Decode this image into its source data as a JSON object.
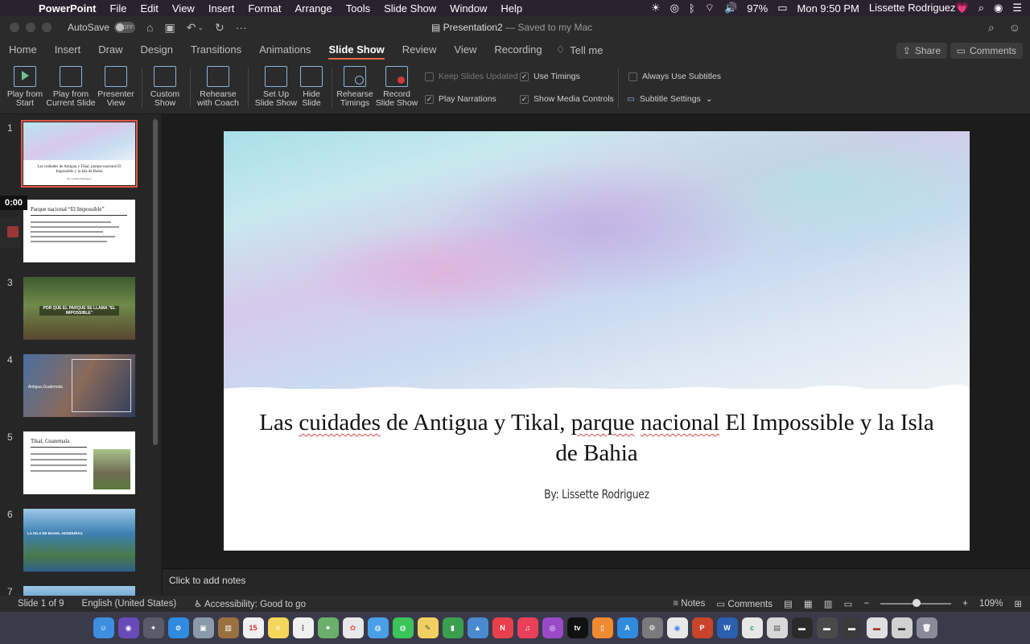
{
  "menubar": {
    "app_name": "PowerPoint",
    "menus": [
      "File",
      "Edit",
      "View",
      "Insert",
      "Format",
      "Arrange",
      "Tools",
      "Slide Show",
      "Window",
      "Help"
    ],
    "battery": "97%",
    "clock": "Mon 9:50 PM",
    "user": "Lissette Rodriguez💗"
  },
  "titlebar": {
    "autosave_label": "AutoSave",
    "autosave_state": "OFF",
    "doc_name": "Presentation2",
    "doc_status": "— Saved to my Mac"
  },
  "tabs": {
    "items": [
      "Home",
      "Insert",
      "Draw",
      "Design",
      "Transitions",
      "Animations",
      "Slide Show",
      "Review",
      "View",
      "Recording"
    ],
    "active": "Slide Show",
    "tell_me": "Tell me",
    "share": "Share",
    "comments": "Comments"
  },
  "ribbon": {
    "play_start": [
      "Play from",
      "Start"
    ],
    "play_current": [
      "Play from",
      "Current Slide"
    ],
    "presenter": [
      "Presenter",
      "View"
    ],
    "custom": [
      "Custom",
      "Show"
    ],
    "rehearse_coach": [
      "Rehearse",
      "with Coach"
    ],
    "setup": [
      "Set Up",
      "Slide Show"
    ],
    "hide": [
      "Hide",
      "Slide"
    ],
    "rehearse_timings": [
      "Rehearse",
      "Timings"
    ],
    "record": [
      "Record",
      "Slide Show"
    ],
    "keep_updated": "Keep Slides Updated",
    "use_timings": "Use Timings",
    "play_narrations": "Play Narrations",
    "show_media": "Show Media Controls",
    "always_subtitles": "Always Use Subtitles",
    "subtitle_settings": "Subtitle Settings"
  },
  "thumbnails": {
    "numbers": [
      "1",
      "2",
      "3",
      "4",
      "5",
      "6",
      "7"
    ],
    "s1_title": "Las cuidades de Antigua y Tikal, parque nacional El Impossible y la Isla de Bahia",
    "s1_sub": "By: Lissette Rodriguez",
    "s2_title": "Parque nacional “El Impossible”",
    "s3_banner": "POR QUE EL PARQUE SE LLAMA \"EL IMPOSSIBLE\"",
    "s4_title": "Antigua,Guatemala",
    "s5_title": "Tikal, Guatemala",
    "s6_title": "LA ISLA DE BAHIA, HONDURAS"
  },
  "recording": {
    "timer": "0:00"
  },
  "slide": {
    "title_parts": [
      "Las ",
      "cuidades",
      " de Antigua y Tikal, ",
      "parque",
      " ",
      "nacional",
      " El Impossible y la Isla de Bahia"
    ],
    "subtitle": "By: Lissette Rodriguez"
  },
  "notes": {
    "placeholder": "Click to add notes"
  },
  "status": {
    "slide_pos": "Slide 1 of 9",
    "language": "English (United States)",
    "accessibility": "Accessibility: Good to go",
    "notes": "Notes",
    "comments": "Comments",
    "zoom": "109%"
  },
  "colors": {
    "accent": "#e66a4a",
    "selection": "#e0584a",
    "menubar": "#2b2230"
  }
}
